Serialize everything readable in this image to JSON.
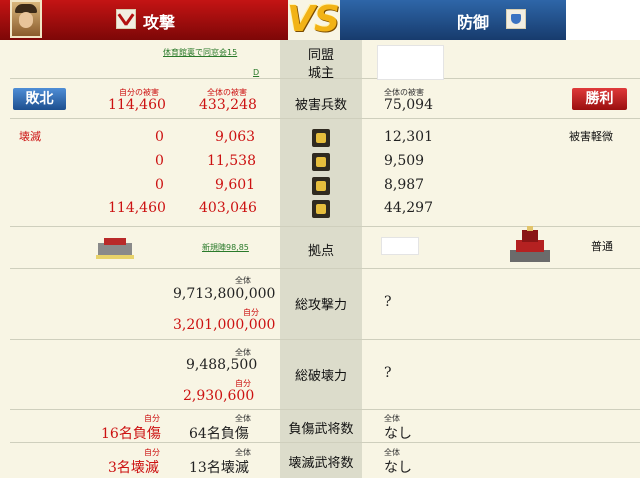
{
  "header": {
    "attack_label": "攻撃",
    "vs_label": "VS",
    "defense_label": "防御"
  },
  "info": {
    "attacker_alliance_link": "体育館裏で同窓会15",
    "attacker_lord_link": "D",
    "alliance_label": "同盟",
    "lord_label": "城主"
  },
  "result": {
    "attacker_result": "敗北",
    "defender_result": "勝利",
    "own_damage_caption": "自分の被害",
    "total_damage_caption": "全体の被害",
    "own_damage": "114,460",
    "total_damage": "433,248",
    "casualties_label": "被害兵数",
    "defender_damage_caption": "全体の被害",
    "defender_damage": "75,094"
  },
  "troops": {
    "attacker_status": "壊滅",
    "defender_status": "被害軽微",
    "rows": [
      {
        "own": "0",
        "total": "9,063",
        "icon": "spearman-icon",
        "defender": "12,301"
      },
      {
        "own": "0",
        "total": "11,538",
        "icon": "archer-icon",
        "defender": "9,509"
      },
      {
        "own": "0",
        "total": "9,601",
        "icon": "cavalry-icon",
        "defender": "8,987"
      },
      {
        "own": "114,460",
        "total": "403,046",
        "icon": "siege-icon",
        "defender": "44,297"
      }
    ]
  },
  "base": {
    "attacker_base_link": "新規陣98,85",
    "base_label": "拠点",
    "defender_base_status": "普通",
    "attacker_base_icon": "camp-icon",
    "defender_base_icon": "castle-icon"
  },
  "attack_power": {
    "total_caption": "全体",
    "total": "9,713,800,000",
    "own_caption": "自分",
    "own": "3,201,000,000",
    "label": "総攻撃力",
    "defender": "?"
  },
  "destruction_power": {
    "total_caption": "全体",
    "total": "9,488,500",
    "own_caption": "自分",
    "own": "2,930,600",
    "label": "総破壊力",
    "defender": "?"
  },
  "injured_generals": {
    "own_caption": "自分",
    "own": "16名負傷",
    "total_caption": "全体",
    "total": "64名負傷",
    "label": "負傷武将数",
    "defender_caption": "全体",
    "defender": "なし"
  },
  "destroyed_generals": {
    "own_caption": "自分",
    "own": "3名壊滅",
    "total_caption": "全体",
    "total": "13名壊滅",
    "label": "壊滅武将数",
    "defender_caption": "全体",
    "defender": "なし"
  },
  "colors": {
    "attack_header": "#c41414",
    "defense_header": "#2e66a8",
    "loss_button": "#2c63aa",
    "win_button": "#c42424",
    "vs_gold": "#f2b316",
    "link_green": "#2a7a2a",
    "value_red": "#cc1111"
  }
}
